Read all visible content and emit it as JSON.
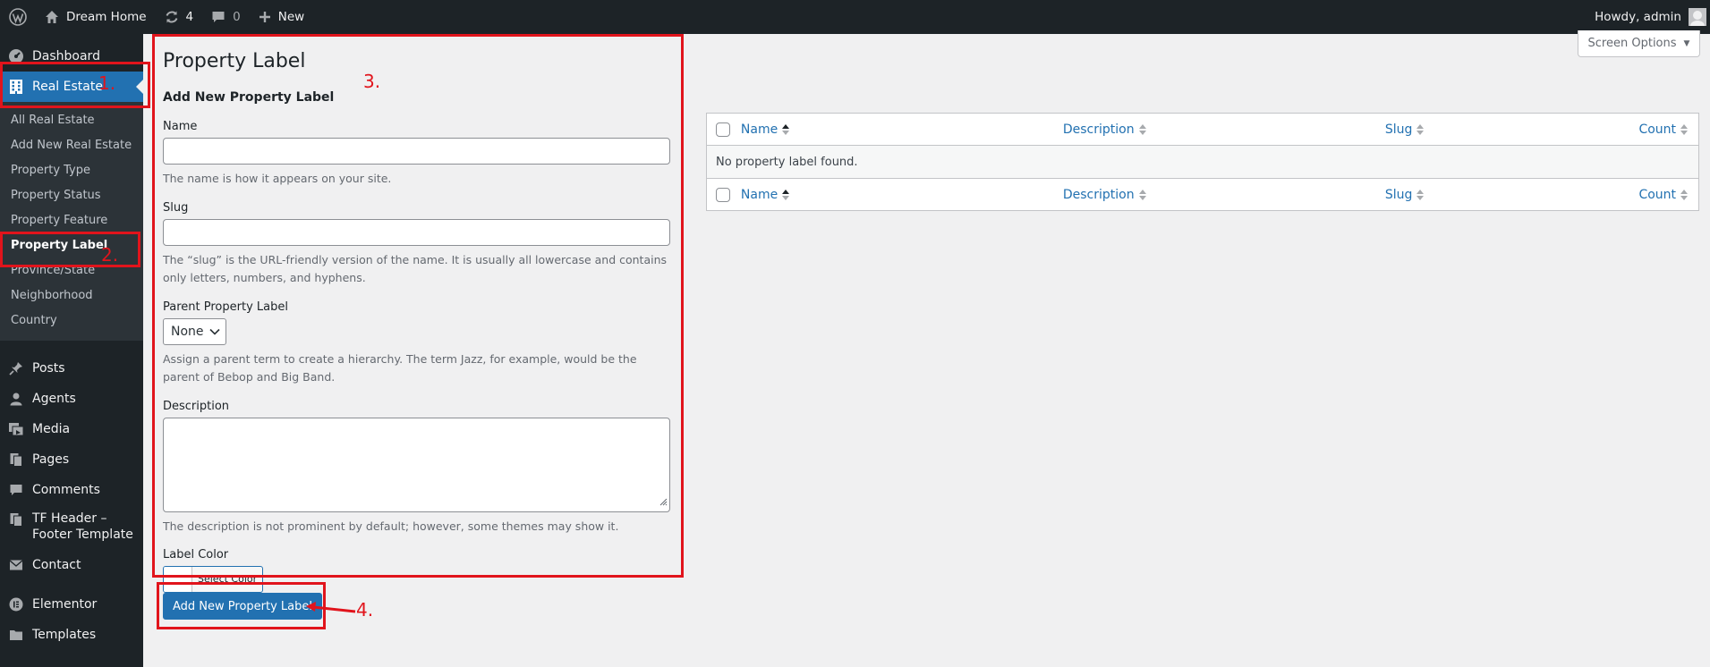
{
  "admin_bar": {
    "site_name": "Dream Home",
    "updates_count": "4",
    "comments_count": "0",
    "new_label": "New",
    "greeting": "Howdy, admin"
  },
  "sidebar": {
    "dashboard": "Dashboard",
    "real_estate": "Real Estate",
    "submenu": [
      "All Real Estate",
      "Add New Real Estate",
      "Property Type",
      "Property Status",
      "Property Feature",
      "Property Label",
      "Province/State",
      "Neighborhood",
      "Country"
    ],
    "items": [
      "Posts",
      "Agents",
      "Media",
      "Pages",
      "Comments",
      "TF Header – Footer Template",
      "Contact",
      "Elementor",
      "Templates"
    ]
  },
  "form": {
    "page_title": "Property Label",
    "section_title": "Add New Property Label",
    "name_label": "Name",
    "name_hint": "The name is how it appears on your site.",
    "slug_label": "Slug",
    "slug_hint": "The “slug” is the URL-friendly version of the name. It is usually all lowercase and contains only letters, numbers, and hyphens.",
    "parent_label": "Parent Property Label",
    "parent_value": "None",
    "parent_hint": "Assign a parent term to create a hierarchy. The term Jazz, for example, would be the parent of Bebop and Big Band.",
    "description_label": "Description",
    "description_hint": "The description is not prominent by default; however, some themes may show it.",
    "color_label": "Label Color",
    "color_button": "Select Color",
    "submit_button": "Add New Property Label"
  },
  "screen_options": "Screen Options",
  "table": {
    "columns": [
      "Name",
      "Description",
      "Slug",
      "Count"
    ],
    "empty_message": "No property label found."
  },
  "annotations": [
    "1.",
    "2.",
    "3.",
    "4."
  ],
  "colors": {
    "accent": "#2271b1",
    "annotation": "#e1141c",
    "admin_dark": "#1d2327"
  }
}
